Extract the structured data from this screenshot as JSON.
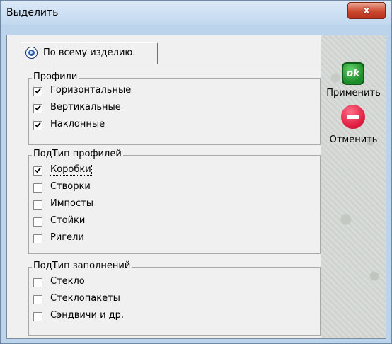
{
  "window": {
    "title": "Выделить",
    "close_label": "x"
  },
  "tab": {
    "label": "По всему изделию"
  },
  "groups": [
    {
      "title": "Профили",
      "items": [
        {
          "label": "Горизонтальные",
          "checked": true
        },
        {
          "label": "Вертикальные",
          "checked": true
        },
        {
          "label": "Наклонные",
          "checked": true
        }
      ]
    },
    {
      "title": "ПодТип профилей",
      "items": [
        {
          "label": "Коробки",
          "checked": true,
          "focused": true
        },
        {
          "label": "Створки",
          "checked": false
        },
        {
          "label": "Импосты",
          "checked": false
        },
        {
          "label": "Стойки",
          "checked": false
        },
        {
          "label": "Ригели",
          "checked": false
        }
      ]
    },
    {
      "title": "ПодТип заполнений",
      "items": [
        {
          "label": "Стекло",
          "checked": false
        },
        {
          "label": "Стеклопакеты",
          "checked": false
        },
        {
          "label": "Сэндвичи и др.",
          "checked": false
        }
      ]
    }
  ],
  "actions": {
    "apply": {
      "icon_text": "ok",
      "label": "Применить"
    },
    "cancel": {
      "label": "Отменить"
    }
  },
  "colors": {
    "ok_icon": "#1d8c2a",
    "cancel_icon": "#e01c40",
    "close_button": "#cb4a2f"
  }
}
